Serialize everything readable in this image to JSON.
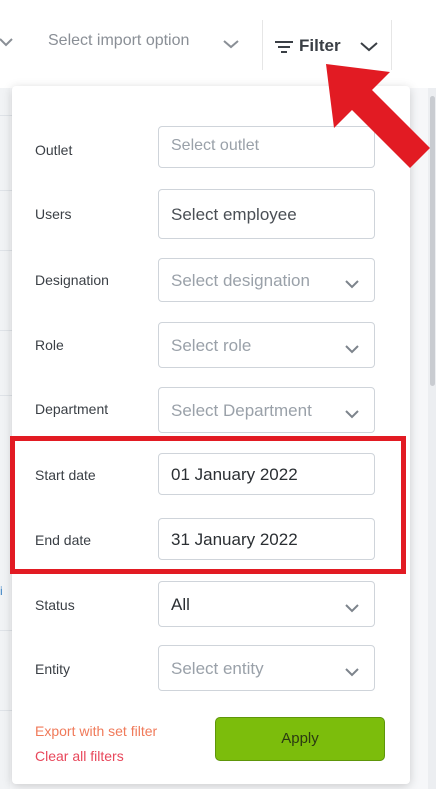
{
  "toolbar": {
    "import_placeholder": "Select import option",
    "filter_label": "Filter"
  },
  "filters": {
    "outlet": {
      "label": "Outlet",
      "placeholder": "Select outlet"
    },
    "users": {
      "label": "Users",
      "placeholder": "Select employee"
    },
    "designation": {
      "label": "Designation",
      "placeholder": "Select designation"
    },
    "role": {
      "label": "Role",
      "placeholder": "Select role"
    },
    "department": {
      "label": "Department",
      "placeholder": "Select Department"
    },
    "start_date": {
      "label": "Start date",
      "value": "01 January 2022"
    },
    "end_date": {
      "label": "End date",
      "value": "31 January 2022"
    },
    "status": {
      "label": "Status",
      "value": "All"
    },
    "entity": {
      "label": "Entity",
      "placeholder": "Select entity"
    }
  },
  "actions": {
    "export_label": "Export with set filter",
    "clear_label": "Clear all filters",
    "apply_label": "Apply"
  },
  "background": {
    "mark": "i"
  },
  "colors": {
    "apply_green": "#7cbd0c",
    "annotation_red": "#e21b23",
    "export_link": "#f07a5a",
    "clear_link": "#e8475b"
  },
  "icons": {
    "filter": "filter-icon",
    "chevron": "chevron-down-icon",
    "arrow": "annotation-arrow"
  }
}
